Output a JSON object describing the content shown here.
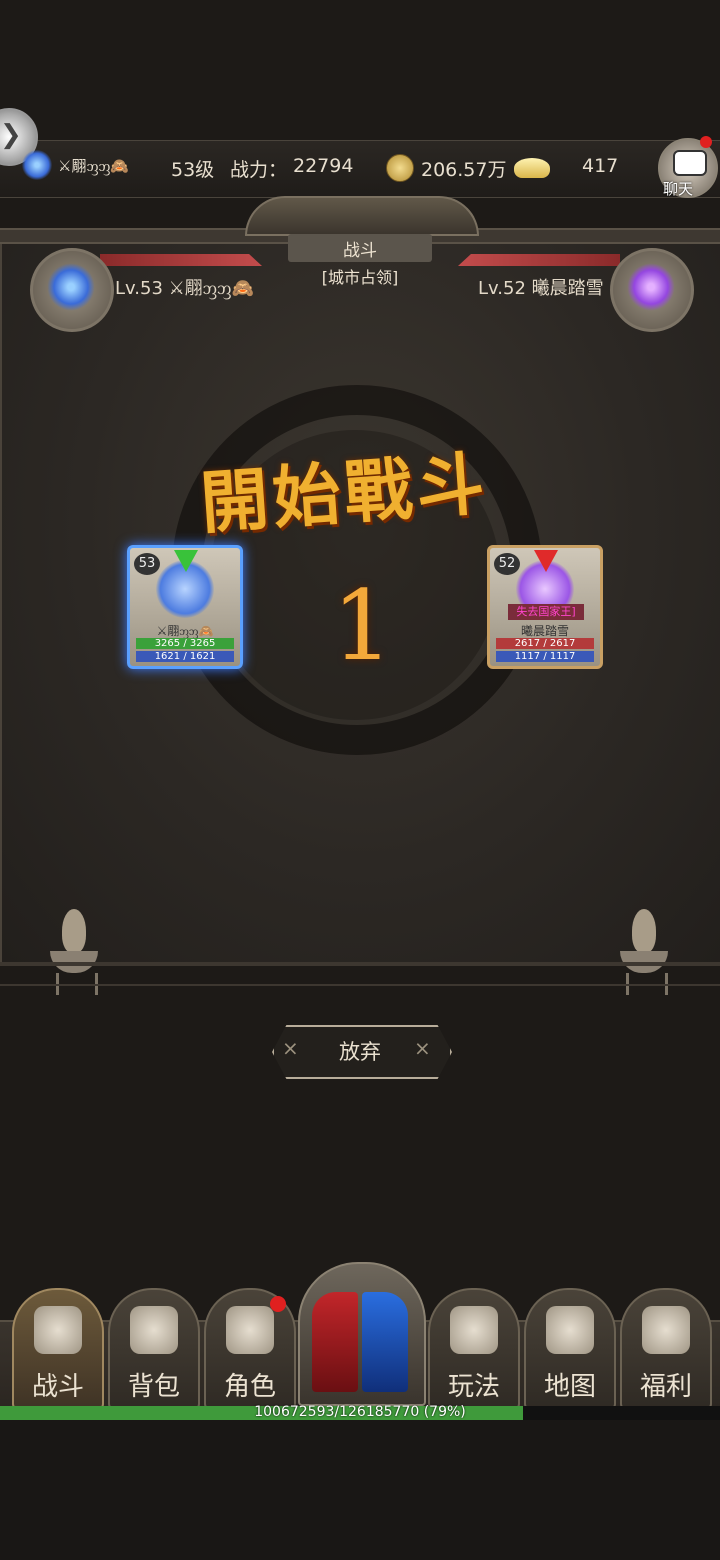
{
  "topbar": {
    "guild_icon": "blue-spear-emblem-icon",
    "player_name": "⚔翢ᦀᦀ🙈",
    "level": "53级",
    "power_label": "战力：",
    "power_value": "22794",
    "gold_icon": "coin-icon",
    "gold_value": "206.57万",
    "ingot_icon": "gold-ingot-icon",
    "ingot_value": "417",
    "chat_label": "聊天"
  },
  "battle": {
    "title": "战斗",
    "subtitle": "[城市占领]",
    "left_player": "Lv.53 ⚔翢ᦀᦀ🙈",
    "right_player": "Lv.52 曦晨踏雪",
    "start_text": "開始戰斗",
    "countdown": "1",
    "abandon_label": "放弃"
  },
  "units": {
    "left": {
      "level": "53",
      "name": "⚔翢ᦀᦀ🙈",
      "hp": "3265 / 3265",
      "mp": "1621 / 1621"
    },
    "right": {
      "level": "52",
      "tag": "失去国家王]",
      "name": "曦晨踏雪",
      "hp": "2617 / 2617",
      "mp": "1117 / 1117"
    }
  },
  "nav": {
    "items": [
      {
        "label": "战斗",
        "icon": "crossed-swords-icon"
      },
      {
        "label": "背包",
        "icon": "backpack-icon"
      },
      {
        "label": "角色",
        "icon": "helmet-icon"
      },
      {
        "label": "玩法",
        "icon": "sword-circle-icon"
      },
      {
        "label": "地图",
        "icon": "map-icon"
      },
      {
        "label": "福利",
        "icon": "treasure-chest-icon"
      }
    ]
  },
  "exp": {
    "text": "100672593/126185770 (79%)",
    "progress": 0.79
  },
  "colors": {
    "accent_gold": "#f0b030",
    "ally_blue": "#5aa0ff",
    "enemy_red": "#e02a2a",
    "exp_green": "#3f9a3b"
  }
}
